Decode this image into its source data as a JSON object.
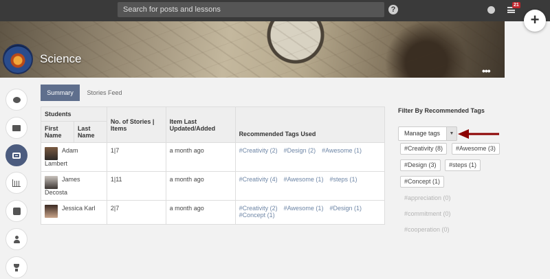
{
  "topbar": {
    "search_placeholder": "Search for posts and lessons",
    "help_glyph": "?",
    "notifications_count": "21",
    "plus_glyph": "+",
    "icons": [
      "help-icon",
      "globe-icon",
      "notifications-icon",
      "plus-icon"
    ]
  },
  "banner": {
    "title": "Science",
    "more_glyph": "•••"
  },
  "leftnav": {
    "items": [
      "chat-icon",
      "folder-icon",
      "stories-icon",
      "analytics-icon",
      "tasks-icon",
      "members-icon",
      "trophy-icon"
    ],
    "active": "stories-icon"
  },
  "tabs": [
    {
      "label": "Summary",
      "active": true
    },
    {
      "label": "Stories Feed",
      "active": false
    }
  ],
  "table": {
    "group_header": "Students",
    "headers": {
      "first_name": "First Name",
      "last_name": "Last Name",
      "stories": "No. of Stories | Items",
      "updated": "Item Last Updated/Added",
      "tags": "Recommended Tags Used"
    },
    "rows": [
      {
        "first": "Adam",
        "last": "Lambert",
        "stories": "1|7",
        "updated": "a month ago",
        "tags": [
          "#Creativity (2)",
          "#Design (2)",
          "#Awesome (1)"
        ]
      },
      {
        "first": "James",
        "last": "Decosta",
        "stories": "1|11",
        "updated": "a month ago",
        "tags": [
          "#Creativity (4)",
          "#Awesome (1)",
          "#steps (1)"
        ]
      },
      {
        "first": "Jessica",
        "last": "Karl",
        "stories": "2|7",
        "updated": "a month ago",
        "tags": [
          "#Creativity (2)",
          "#Awesome (1)",
          "#Design (1)",
          "#Concept (1)"
        ]
      }
    ]
  },
  "filter": {
    "title": "Filter By Recommended Tags",
    "manage_label": "Manage tags",
    "active_tags": [
      "#Creativity (8)",
      "#Awesome (3)",
      "#Design (3)",
      "#steps (1)",
      "#Concept (1)"
    ],
    "inactive_tags": [
      "#appreciation (0)",
      "#commitment (0)",
      "#cooperation (0)"
    ]
  },
  "colors": {
    "accent": "#5f6f8d",
    "tag_link": "#6e86a6",
    "arrow": "#8b0000"
  }
}
